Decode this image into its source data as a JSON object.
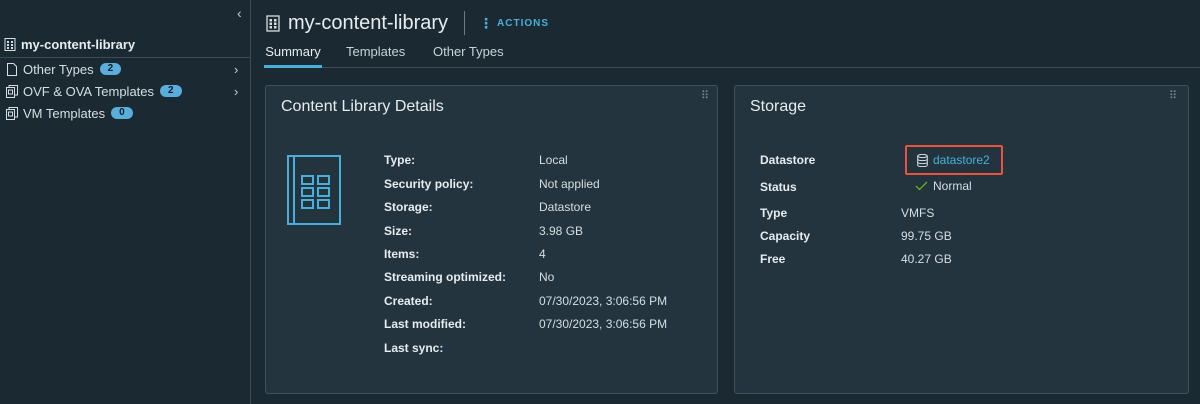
{
  "sidebar": {
    "collapse_glyph": "‹",
    "library_name": "my-content-library",
    "items": [
      {
        "label": "Other Types",
        "count": "2"
      },
      {
        "label": "OVF & OVA Templates",
        "count": "2"
      },
      {
        "label": "VM Templates",
        "count": "0"
      }
    ]
  },
  "header": {
    "title": "my-content-library",
    "actions_label": "ACTIONS",
    "tabs": [
      {
        "label": "Summary",
        "active": true
      },
      {
        "label": "Templates",
        "active": false
      },
      {
        "label": "Other Types",
        "active": false
      }
    ]
  },
  "details": {
    "title": "Content Library Details",
    "rows": [
      {
        "label": "Type:",
        "value": "Local"
      },
      {
        "label": "Security policy:",
        "value": "Not applied"
      },
      {
        "label": "Storage:",
        "value": "Datastore"
      },
      {
        "label": "Size:",
        "value": "3.98 GB"
      },
      {
        "label": "Items:",
        "value": "4"
      },
      {
        "label": "Streaming optimized:",
        "value": "No"
      },
      {
        "label": "Created:",
        "value": "07/30/2023, 3:06:56 PM"
      },
      {
        "label": "Last modified:",
        "value": "07/30/2023, 3:06:56 PM"
      },
      {
        "label": "Last sync:",
        "value": ""
      }
    ]
  },
  "storage": {
    "title": "Storage",
    "datastore_label": "Datastore",
    "datastore_value": "datastore2",
    "status_label": "Status",
    "status_value": "Normal",
    "type_label": "Type",
    "type_value": "VMFS",
    "capacity_label": "Capacity",
    "capacity_value": "99.75 GB",
    "free_label": "Free",
    "free_value": "40.27 GB"
  },
  "colors": {
    "accent": "#49afd9",
    "badge": "#5aaedc",
    "highlight_border": "#e8543f",
    "status_ok": "#5eb715"
  },
  "icons": {
    "library": "content-library-icon",
    "other_types": "file-icon",
    "ovf": "ovf-template-icon",
    "vm": "vm-template-icon",
    "datastore": "datastore-icon",
    "status": "checkmark-icon"
  }
}
